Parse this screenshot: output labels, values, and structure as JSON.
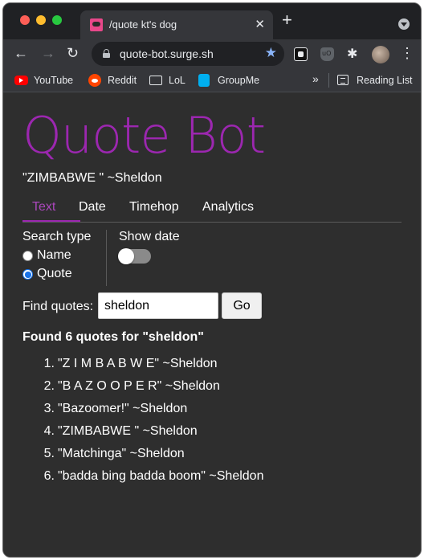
{
  "browser": {
    "tab_title": "/quote kt's dog",
    "tab_close": "✕",
    "new_tab": "+",
    "url": "quote-bot.surge.sh",
    "bookmarks": [
      {
        "label": "YouTube",
        "icon": "youtube-icon"
      },
      {
        "label": "Reddit",
        "icon": "reddit-icon"
      },
      {
        "label": "LoL",
        "icon": "folder-icon"
      },
      {
        "label": "GroupMe",
        "icon": "groupme-icon"
      }
    ],
    "bookmarks_overflow": "»",
    "reading_list": "Reading List"
  },
  "app": {
    "title": "Quote Bot",
    "quote_of_day": "\"ZIMBABWE \" ~Sheldon",
    "accent_color": "#9c27b0",
    "tabs": [
      "Text",
      "Date",
      "Timehop",
      "Analytics"
    ],
    "active_tab": "Text",
    "search_type": {
      "label": "Search type",
      "options": [
        "Name",
        "Quote"
      ],
      "selected": "Quote"
    },
    "show_date": {
      "label": "Show date",
      "enabled": false
    },
    "find": {
      "label": "Find quotes:",
      "value": "sheldon",
      "button": "Go"
    },
    "results_heading": "Found 6 quotes for \"sheldon\"",
    "results": [
      {
        "num": "1.",
        "text": "\"Z I M B A B W E\" ~Sheldon"
      },
      {
        "num": "2.",
        "text": "\"B A Z O O P E R\" ~Sheldon"
      },
      {
        "num": "3.",
        "text": "\"Bazoomer!\" ~Sheldon"
      },
      {
        "num": "4.",
        "text": "\"ZIMBABWE \" ~Sheldon"
      },
      {
        "num": "5.",
        "text": "\"Matchinga\" ~Sheldon"
      },
      {
        "num": "6.",
        "text": "\"badda bing badda boom\" ~Sheldon"
      }
    ]
  }
}
